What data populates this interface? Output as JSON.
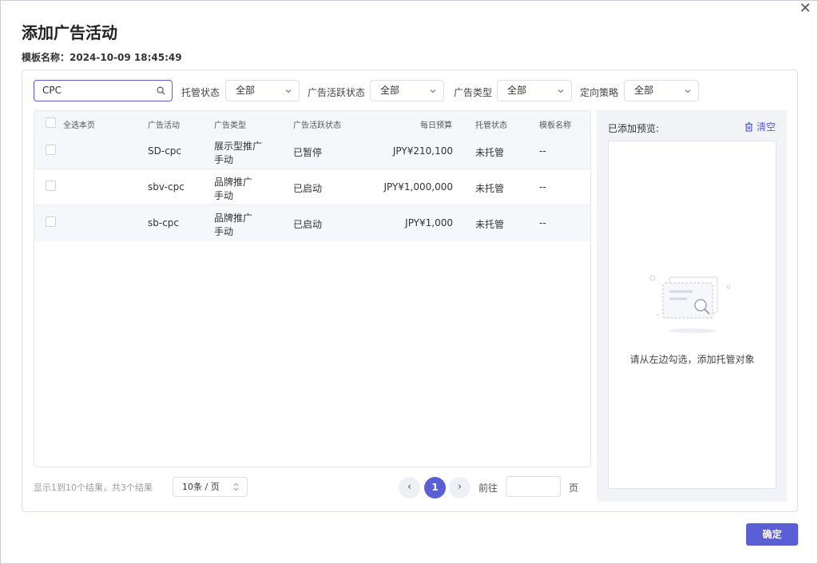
{
  "dialog": {
    "title": "添加广告活动",
    "template_name": "模板名称：2024-10-09 18:45:49",
    "confirm_label": "确定",
    "close_icon": "close-icon"
  },
  "filters": {
    "search_value": "CPC",
    "managed_status_label": "托管状态",
    "managed_status_value": "全部",
    "active_status_label": "广告活跃状态",
    "active_status_value": "全部",
    "ad_type_label": "广告类型",
    "ad_type_value": "全部",
    "strategy_label": "定向策略",
    "strategy_value": "全部"
  },
  "table": {
    "headers": {
      "select_all": "全选本页",
      "campaign": "广告活动",
      "ad_type": "广告类型",
      "active_status": "广告活跃状态",
      "daily_budget": "每日预算",
      "managed_status": "托管状态",
      "template_name": "模板名称"
    },
    "rows": [
      {
        "campaign": "SD-cpc",
        "ad_type_line1": "展示型推广",
        "ad_type_line2": "手动",
        "active_status": "已暂停",
        "daily_budget": "JPY¥210,100",
        "managed_status": "未托管",
        "template_name": "--"
      },
      {
        "campaign": "sbv-cpc",
        "ad_type_line1": "品牌推广",
        "ad_type_line2": "手动",
        "active_status": "已启动",
        "daily_budget": "JPY¥1,000,000",
        "managed_status": "未托管",
        "template_name": "--"
      },
      {
        "campaign": "sb-cpc",
        "ad_type_line1": "品牌推广",
        "ad_type_line2": "手动",
        "active_status": "已启动",
        "daily_budget": "JPY¥1,000",
        "managed_status": "未托管",
        "template_name": "--"
      }
    ]
  },
  "pagination": {
    "summary": "显示1到10个结果，共3个结果",
    "page_size": "10条 / 页",
    "prev": "‹",
    "current_page": "1",
    "next": "›",
    "goto_label": "前往",
    "page_suffix": "页"
  },
  "preview": {
    "title": "已添加预览:",
    "clear_label": "清空",
    "empty_text": "请从左边勾选，添加托管对象"
  },
  "colors": {
    "accent": "#5a5fd6",
    "row_alt": "#f6f7fa",
    "panel_bg": "#f2f3f7"
  }
}
